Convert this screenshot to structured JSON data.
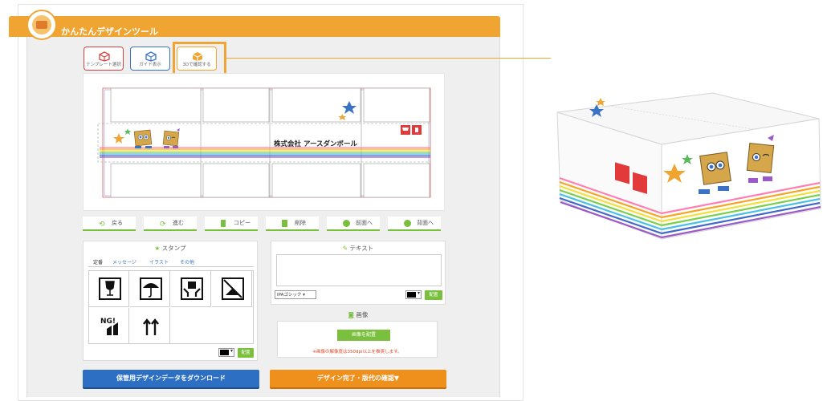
{
  "app": {
    "title": "かんたんデザインツール"
  },
  "toolbar": {
    "template_label": "テンプレート選択",
    "guide_label": "ガイド表示",
    "preview3d_label": "3Dで確認する"
  },
  "canvas": {
    "company_name": "株式会社 アースダンボール"
  },
  "edit_bar": {
    "back": "戻る",
    "forward": "進む",
    "copy": "コピー",
    "delete": "削除",
    "to_front": "前面へ",
    "to_back": "背面へ"
  },
  "stamp_panel": {
    "title": "スタンプ",
    "tabs": [
      "定番",
      "メッセージ",
      "イラスト",
      "その他"
    ],
    "stamps": [
      "fragile-icon",
      "keep-dry-icon",
      "handle-with-care-icon",
      "no-hook-icon",
      "ng-stack-icon",
      "this-way-up-icon"
    ],
    "place_label": "配置"
  },
  "text_panel": {
    "title": "テキスト",
    "font_select": "IPAゴシック ▾",
    "place_label": "配置"
  },
  "image_panel": {
    "title": "画像",
    "place_button": "画像を配置",
    "note": "※画像の解像度は350dpi以上を推奨します。"
  },
  "actions": {
    "download": "保管用デザインデータをダウンロード",
    "complete": "デザイン完了・版代の確認▼"
  },
  "colors": {
    "brand_orange": "#f0a431",
    "action_blue": "#2d6fc2",
    "action_orange": "#ef8f1c",
    "green": "#7bbf3e",
    "red": "#d94040"
  }
}
